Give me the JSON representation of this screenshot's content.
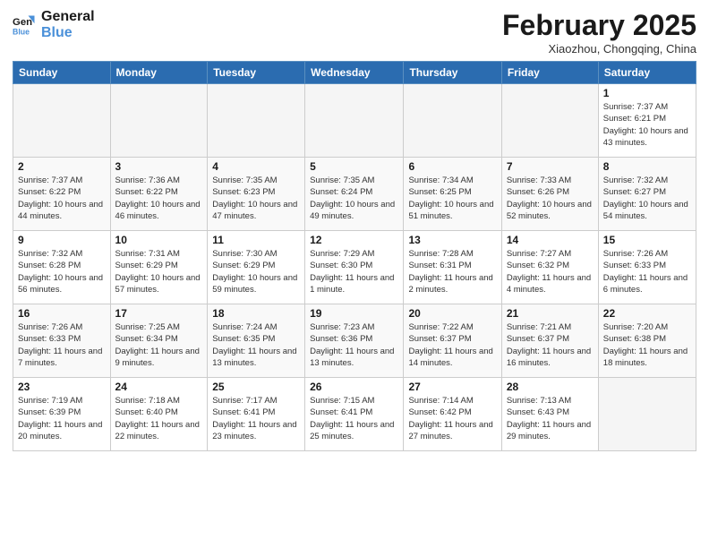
{
  "header": {
    "logo_line1": "General",
    "logo_line2": "Blue",
    "month_title": "February 2025",
    "subtitle": "Xiaozhou, Chongqing, China"
  },
  "weekdays": [
    "Sunday",
    "Monday",
    "Tuesday",
    "Wednesday",
    "Thursday",
    "Friday",
    "Saturday"
  ],
  "weeks": [
    [
      {
        "day": "",
        "info": ""
      },
      {
        "day": "",
        "info": ""
      },
      {
        "day": "",
        "info": ""
      },
      {
        "day": "",
        "info": ""
      },
      {
        "day": "",
        "info": ""
      },
      {
        "day": "",
        "info": ""
      },
      {
        "day": "1",
        "info": "Sunrise: 7:37 AM\nSunset: 6:21 PM\nDaylight: 10 hours and 43 minutes."
      }
    ],
    [
      {
        "day": "2",
        "info": "Sunrise: 7:37 AM\nSunset: 6:22 PM\nDaylight: 10 hours and 44 minutes."
      },
      {
        "day": "3",
        "info": "Sunrise: 7:36 AM\nSunset: 6:22 PM\nDaylight: 10 hours and 46 minutes."
      },
      {
        "day": "4",
        "info": "Sunrise: 7:35 AM\nSunset: 6:23 PM\nDaylight: 10 hours and 47 minutes."
      },
      {
        "day": "5",
        "info": "Sunrise: 7:35 AM\nSunset: 6:24 PM\nDaylight: 10 hours and 49 minutes."
      },
      {
        "day": "6",
        "info": "Sunrise: 7:34 AM\nSunset: 6:25 PM\nDaylight: 10 hours and 51 minutes."
      },
      {
        "day": "7",
        "info": "Sunrise: 7:33 AM\nSunset: 6:26 PM\nDaylight: 10 hours and 52 minutes."
      },
      {
        "day": "8",
        "info": "Sunrise: 7:32 AM\nSunset: 6:27 PM\nDaylight: 10 hours and 54 minutes."
      }
    ],
    [
      {
        "day": "9",
        "info": "Sunrise: 7:32 AM\nSunset: 6:28 PM\nDaylight: 10 hours and 56 minutes."
      },
      {
        "day": "10",
        "info": "Sunrise: 7:31 AM\nSunset: 6:29 PM\nDaylight: 10 hours and 57 minutes."
      },
      {
        "day": "11",
        "info": "Sunrise: 7:30 AM\nSunset: 6:29 PM\nDaylight: 10 hours and 59 minutes."
      },
      {
        "day": "12",
        "info": "Sunrise: 7:29 AM\nSunset: 6:30 PM\nDaylight: 11 hours and 1 minute."
      },
      {
        "day": "13",
        "info": "Sunrise: 7:28 AM\nSunset: 6:31 PM\nDaylight: 11 hours and 2 minutes."
      },
      {
        "day": "14",
        "info": "Sunrise: 7:27 AM\nSunset: 6:32 PM\nDaylight: 11 hours and 4 minutes."
      },
      {
        "day": "15",
        "info": "Sunrise: 7:26 AM\nSunset: 6:33 PM\nDaylight: 11 hours and 6 minutes."
      }
    ],
    [
      {
        "day": "16",
        "info": "Sunrise: 7:26 AM\nSunset: 6:33 PM\nDaylight: 11 hours and 7 minutes."
      },
      {
        "day": "17",
        "info": "Sunrise: 7:25 AM\nSunset: 6:34 PM\nDaylight: 11 hours and 9 minutes."
      },
      {
        "day": "18",
        "info": "Sunrise: 7:24 AM\nSunset: 6:35 PM\nDaylight: 11 hours and 13 minutes."
      },
      {
        "day": "19",
        "info": "Sunrise: 7:23 AM\nSunset: 6:36 PM\nDaylight: 11 hours and 13 minutes."
      },
      {
        "day": "20",
        "info": "Sunrise: 7:22 AM\nSunset: 6:37 PM\nDaylight: 11 hours and 14 minutes."
      },
      {
        "day": "21",
        "info": "Sunrise: 7:21 AM\nSunset: 6:37 PM\nDaylight: 11 hours and 16 minutes."
      },
      {
        "day": "22",
        "info": "Sunrise: 7:20 AM\nSunset: 6:38 PM\nDaylight: 11 hours and 18 minutes."
      }
    ],
    [
      {
        "day": "23",
        "info": "Sunrise: 7:19 AM\nSunset: 6:39 PM\nDaylight: 11 hours and 20 minutes."
      },
      {
        "day": "24",
        "info": "Sunrise: 7:18 AM\nSunset: 6:40 PM\nDaylight: 11 hours and 22 minutes."
      },
      {
        "day": "25",
        "info": "Sunrise: 7:17 AM\nSunset: 6:41 PM\nDaylight: 11 hours and 23 minutes."
      },
      {
        "day": "26",
        "info": "Sunrise: 7:15 AM\nSunset: 6:41 PM\nDaylight: 11 hours and 25 minutes."
      },
      {
        "day": "27",
        "info": "Sunrise: 7:14 AM\nSunset: 6:42 PM\nDaylight: 11 hours and 27 minutes."
      },
      {
        "day": "28",
        "info": "Sunrise: 7:13 AM\nSunset: 6:43 PM\nDaylight: 11 hours and 29 minutes."
      },
      {
        "day": "",
        "info": ""
      }
    ]
  ]
}
